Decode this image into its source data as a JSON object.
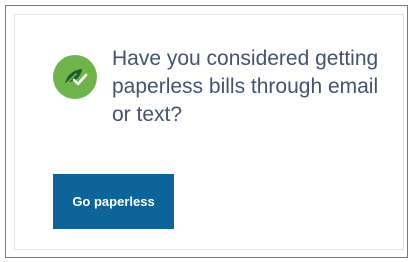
{
  "prompt": {
    "icon": "leaf-check-icon",
    "accent_color": "#6fb44a",
    "text_color": "#44546a",
    "message": "Have you considered getting paperless bills through email or text?"
  },
  "cta": {
    "label": "Go paperless",
    "background_color": "#0d6499",
    "text_color": "#ffffff"
  }
}
